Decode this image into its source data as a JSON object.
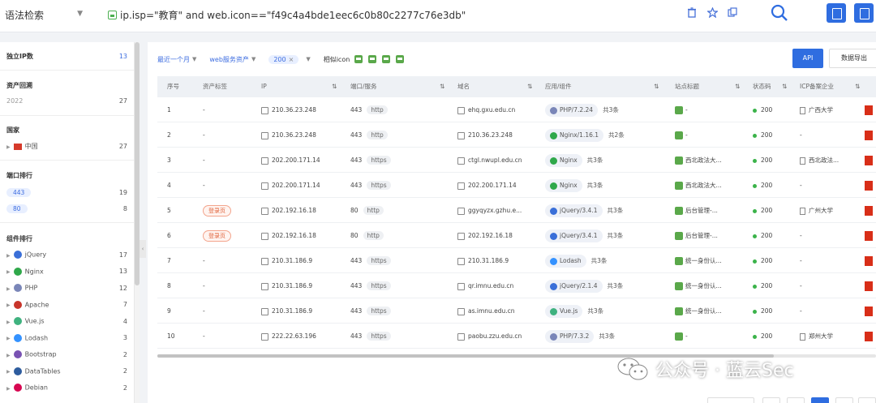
{
  "topbar": {
    "mode": "语法检索",
    "query": "ip.isp=\"教育\" and web.icon==\"f49c4a4bde1eec6c0b80c2277c76e3db\""
  },
  "sidebar": {
    "unique_ip": {
      "label": "独立IP数",
      "count": "13"
    },
    "assets_year": {
      "label": "资产回溯",
      "year": "2022",
      "count": "27"
    },
    "country": {
      "label": "国家",
      "items": [
        {
          "name": "中国",
          "count": "27"
        }
      ]
    },
    "ports": {
      "label": "端口排行",
      "items": [
        {
          "name": "443",
          "count": "19"
        },
        {
          "name": "80",
          "count": "8"
        }
      ]
    },
    "components": {
      "label": "组件排行",
      "items": [
        {
          "name": "jQuery",
          "count": "17",
          "color": "#3a6fd8"
        },
        {
          "name": "Nginx",
          "count": "13",
          "color": "#2fa84a"
        },
        {
          "name": "PHP",
          "count": "12",
          "color": "#7a86b8"
        },
        {
          "name": "Apache",
          "count": "7",
          "color": "#c8352b"
        },
        {
          "name": "Vue.js",
          "count": "4",
          "color": "#3fb27f"
        },
        {
          "name": "Lodash",
          "count": "3",
          "color": "#3492ff"
        },
        {
          "name": "Bootstrap",
          "count": "2",
          "color": "#7952b3"
        },
        {
          "name": "DataTables",
          "count": "2",
          "color": "#2e5c9e"
        },
        {
          "name": "Debian",
          "count": "2",
          "color": "#d70751"
        }
      ]
    }
  },
  "filters": {
    "time": "最近一个月",
    "service": "web服务资产",
    "size_tag": "200",
    "icon_label": "相似icon",
    "api_label": "API",
    "export_label": "数据导出"
  },
  "table": {
    "columns": [
      "序号",
      "资产标签",
      "IP",
      "端口/服务",
      "域名",
      "应用/组件",
      "站点标题",
      "状态码",
      "ICP备案企业"
    ],
    "rows": [
      {
        "idx": "1",
        "tag": "-",
        "ip": "210.36.23.248",
        "port": "443",
        "proto": "http",
        "domain": "ehq.gxu.edu.cn",
        "app": "PHP/7.2.24",
        "app_color": "#7a86b8",
        "more": "共3条",
        "title": "-",
        "status": "200",
        "icp": "广西大学"
      },
      {
        "idx": "2",
        "tag": "-",
        "ip": "210.36.23.248",
        "port": "443",
        "proto": "http",
        "domain": "210.36.23.248",
        "app": "Nginx/1.16.1",
        "app_color": "#2fa84a",
        "more": "共2条",
        "title": "-",
        "status": "200",
        "icp": "-"
      },
      {
        "idx": "3",
        "tag": "-",
        "ip": "202.200.171.14",
        "port": "443",
        "proto": "https",
        "domain": "ctgl.nwupl.edu.cn",
        "app": "Nginx",
        "app_color": "#2fa84a",
        "more": "共3条",
        "title": "西北政法大...",
        "status": "200",
        "icp": "西北政法..."
      },
      {
        "idx": "4",
        "tag": "-",
        "ip": "202.200.171.14",
        "port": "443",
        "proto": "https",
        "domain": "202.200.171.14",
        "app": "Nginx",
        "app_color": "#2fa84a",
        "more": "共3条",
        "title": "西北政法大...",
        "status": "200",
        "icp": "-"
      },
      {
        "idx": "5",
        "tag": "登录页",
        "ip": "202.192.16.18",
        "port": "80",
        "proto": "http",
        "domain": "ggyqyzx.gzhu.e...",
        "app": "jQuery/3.4.1",
        "app_color": "#3a6fd8",
        "more": "共3条",
        "title": "后台管理-...",
        "status": "200",
        "icp": "广州大学"
      },
      {
        "idx": "6",
        "tag": "登录页",
        "ip": "202.192.16.18",
        "port": "80",
        "proto": "http",
        "domain": "202.192.16.18",
        "app": "jQuery/3.4.1",
        "app_color": "#3a6fd8",
        "more": "共3条",
        "title": "后台管理-...",
        "status": "200",
        "icp": "-"
      },
      {
        "idx": "7",
        "tag": "-",
        "ip": "210.31.186.9",
        "port": "443",
        "proto": "https",
        "domain": "210.31.186.9",
        "app": "Lodash",
        "app_color": "#3492ff",
        "more": "共3条",
        "title": "统一身份认...",
        "status": "200",
        "icp": "-"
      },
      {
        "idx": "8",
        "tag": "-",
        "ip": "210.31.186.9",
        "port": "443",
        "proto": "https",
        "domain": "qr.imnu.edu.cn",
        "app": "jQuery/2.1.4",
        "app_color": "#3a6fd8",
        "more": "共3条",
        "title": "统一身份认...",
        "status": "200",
        "icp": "-"
      },
      {
        "idx": "9",
        "tag": "-",
        "ip": "210.31.186.9",
        "port": "443",
        "proto": "https",
        "domain": "as.imnu.edu.cn",
        "app": "Vue.js",
        "app_color": "#3fb27f",
        "more": "共3条",
        "title": "统一身份认...",
        "status": "200",
        "icp": "-"
      },
      {
        "idx": "10",
        "tag": "-",
        "ip": "222.22.63.196",
        "port": "443",
        "proto": "https",
        "domain": "paobu.zzu.edu.cn",
        "app": "PHP/7.3.2",
        "app_color": "#7a86b8",
        "more": "共3条",
        "title": "-",
        "status": "200",
        "icp": "郑州大学"
      }
    ]
  },
  "watermark": {
    "text": "公众号 · 蓝云Sec"
  }
}
